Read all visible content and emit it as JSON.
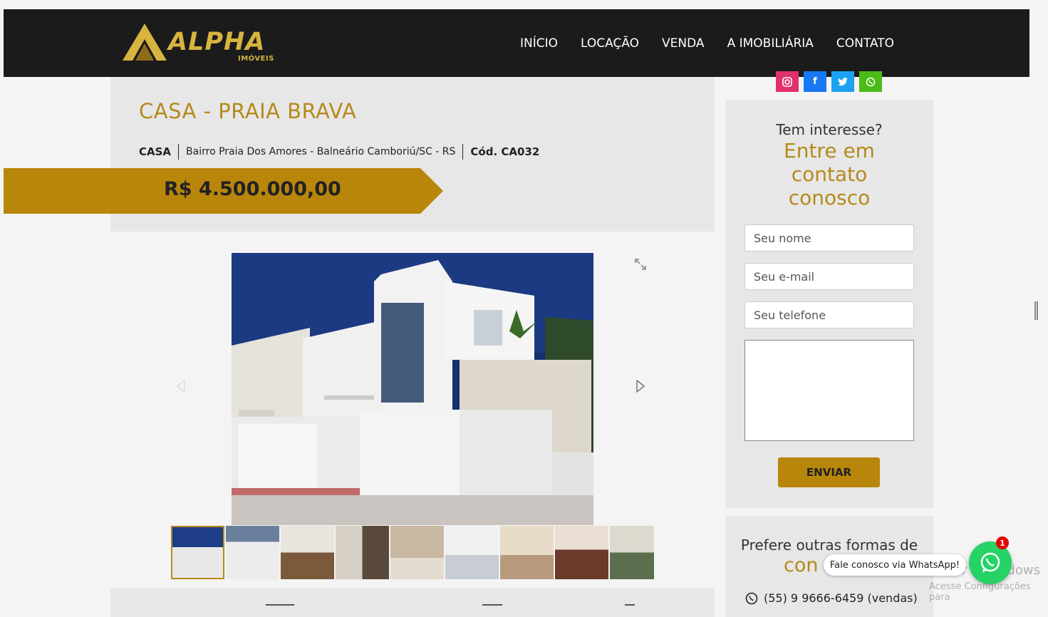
{
  "brand": {
    "name": "ALPHA",
    "sub": "IMÓVEIS",
    "color": "#d6b43f"
  },
  "nav": {
    "items": [
      "INÍCIO",
      "LOCAÇÃO",
      "VENDA",
      "A IMOBILIÁRIA",
      "CONTATO"
    ]
  },
  "social": [
    {
      "icon": "instagram-icon",
      "color": "#e1306c"
    },
    {
      "icon": "facebook-icon",
      "color": "#1877f2"
    },
    {
      "icon": "twitter-icon",
      "color": "#1da1f2"
    },
    {
      "icon": "whatsapp-icon",
      "color": "#4cbb17"
    }
  ],
  "property": {
    "title": "CASA - PRAIA BRAVA",
    "type": "CASA",
    "location": "Bairro Praia Dos Amores - Balneário Camboriú/SC - RS",
    "code": "Cód. CA032",
    "price": "R$ 4.500.000,00"
  },
  "gallery": {
    "thumb_count": 9,
    "active_index": 0
  },
  "form": {
    "question": "Tem interesse?",
    "cta": "Entre em contato conosco",
    "name_placeholder": "Seu nome",
    "email_placeholder": "Seu e-mail",
    "phone_placeholder": "Seu telefone",
    "send_label": "ENVIAR"
  },
  "contact": {
    "question": "Prefere outras formas de",
    "cta_partial": "con",
    "phone": "(55) 9 9666-6459 (vendas)"
  },
  "whatsapp": {
    "bubble": "Fale conosco via WhatsApp!",
    "badge": "1"
  },
  "system": {
    "activate_title": "Ativar o Windows",
    "activate_sub": "Acesse Configurações para"
  },
  "colors": {
    "gold": "#b8860b",
    "dark": "#1b1b1b"
  }
}
